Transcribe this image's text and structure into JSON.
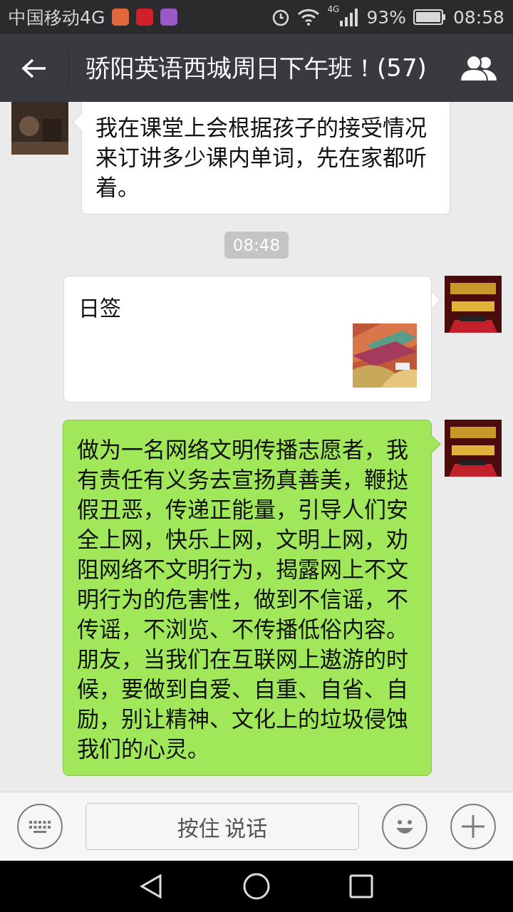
{
  "status_bar": {
    "carrier": "中国移动4G",
    "network": "4G",
    "battery": "93%",
    "time": "08:58"
  },
  "header": {
    "title": "骄阳英语西城周日下午班！(57)"
  },
  "messages": [
    {
      "kind": "text",
      "outgoing": false,
      "text": "我在课堂上会根据孩子的接受情况来订讲多少课内单词，先在家都听着。"
    },
    {
      "kind": "time",
      "text": "08:48"
    },
    {
      "kind": "link",
      "outgoing": true,
      "title": "日签"
    },
    {
      "kind": "text",
      "outgoing": true,
      "text": "做为一名网络文明传播志愿者，我有责任有义务去宣扬真善美，鞭挞假丑恶，传递正能量，引导人们安全上网，快乐上网，文明上网，劝阻网络不文明行为，揭露网上不文明行为的危害性，做到不信谣，不传谣，不浏览、不传播低俗内容。朋友，当我们在互联网上遨游的时候，要做到自爱、自重、自省、自励，别让精神、文化上的垃圾侵蚀我们的心灵。"
    }
  ],
  "input_bar": {
    "hold_to_talk": "按住 说话"
  }
}
